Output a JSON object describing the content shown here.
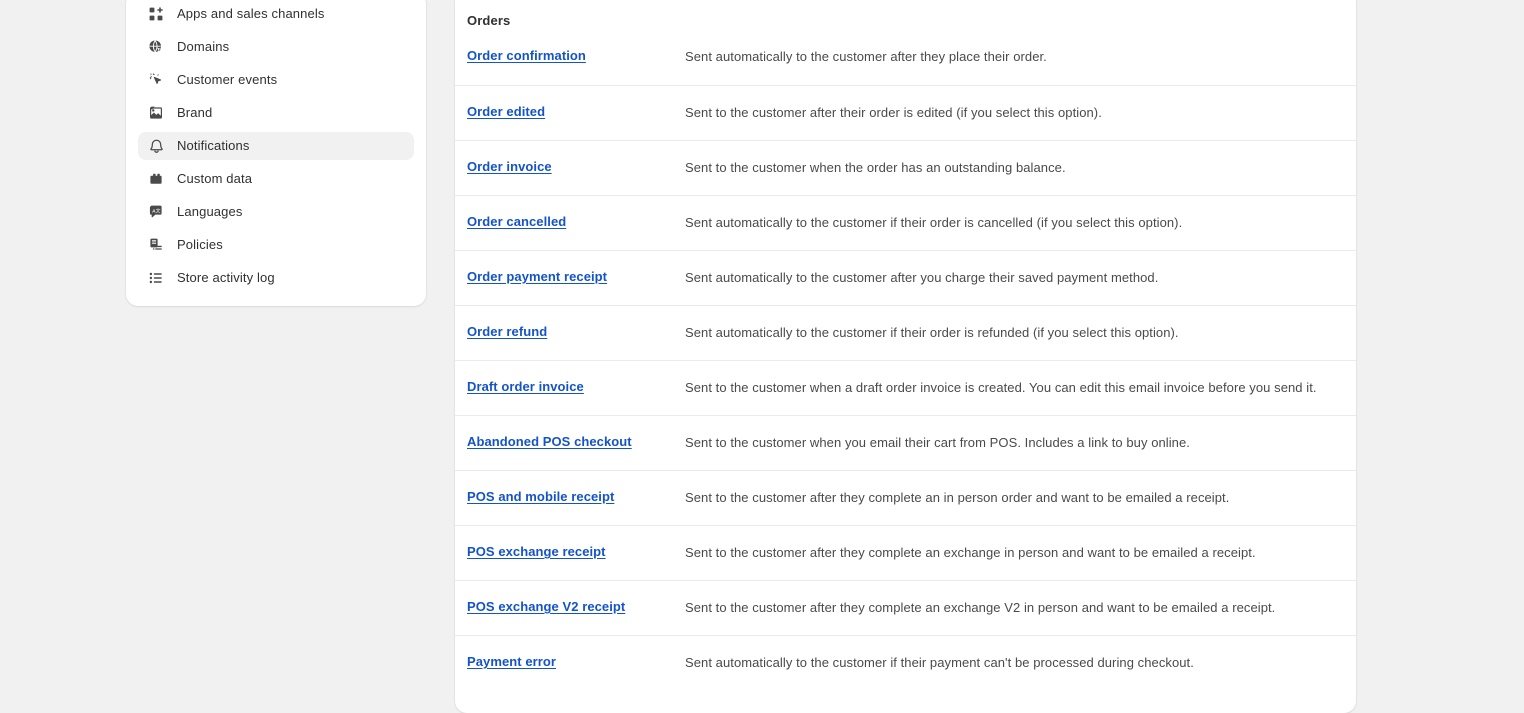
{
  "sidebar": {
    "items": [
      {
        "label": "Apps and sales channels",
        "icon": "apps-icon",
        "active": false
      },
      {
        "label": "Domains",
        "icon": "globe-icon",
        "active": false
      },
      {
        "label": "Customer events",
        "icon": "cursor-sparkle-icon",
        "active": false
      },
      {
        "label": "Brand",
        "icon": "image-icon",
        "active": false
      },
      {
        "label": "Notifications",
        "icon": "bell-icon",
        "active": true
      },
      {
        "label": "Custom data",
        "icon": "database-icon",
        "active": false
      },
      {
        "label": "Languages",
        "icon": "translate-icon",
        "active": false
      },
      {
        "label": "Policies",
        "icon": "policy-icon",
        "active": false
      },
      {
        "label": "Store activity log",
        "icon": "list-icon",
        "active": false
      }
    ]
  },
  "main": {
    "section_title": "Orders",
    "rows": [
      {
        "label": "Order confirmation",
        "description": "Sent automatically to the customer after they place their order."
      },
      {
        "label": "Order edited",
        "description": "Sent to the customer after their order is edited (if you select this option)."
      },
      {
        "label": "Order invoice",
        "description": "Sent to the customer when the order has an outstanding balance."
      },
      {
        "label": "Order cancelled",
        "description": "Sent automatically to the customer if their order is cancelled (if you select this option)."
      },
      {
        "label": "Order payment receipt",
        "description": "Sent automatically to the customer after you charge their saved payment method."
      },
      {
        "label": "Order refund",
        "description": "Sent automatically to the customer if their order is refunded (if you select this option)."
      },
      {
        "label": "Draft order invoice",
        "description": "Sent to the customer when a draft order invoice is created. You can edit this email invoice before you send it."
      },
      {
        "label": "Abandoned POS checkout",
        "description": "Sent to the customer when you email their cart from POS. Includes a link to buy online."
      },
      {
        "label": "POS and mobile receipt",
        "description": "Sent to the customer after they complete an in person order and want to be emailed a receipt."
      },
      {
        "label": "POS exchange receipt",
        "description": "Sent to the customer after they complete an exchange in person and want to be emailed a receipt."
      },
      {
        "label": "POS exchange V2 receipt",
        "description": "Sent to the customer after they complete an exchange V2 in person and want to be emailed a receipt."
      },
      {
        "label": "Payment error",
        "description": "Sent automatically to the customer if their payment can't be processed during checkout."
      }
    ]
  },
  "colors": {
    "page_background": "#f1f1f1",
    "card_background": "#ffffff",
    "link": "#1453c8",
    "text": "#303030",
    "muted_text": "#4a4a4a",
    "divider": "#ebebeb",
    "active_nav_background": "#f1f1f1"
  }
}
